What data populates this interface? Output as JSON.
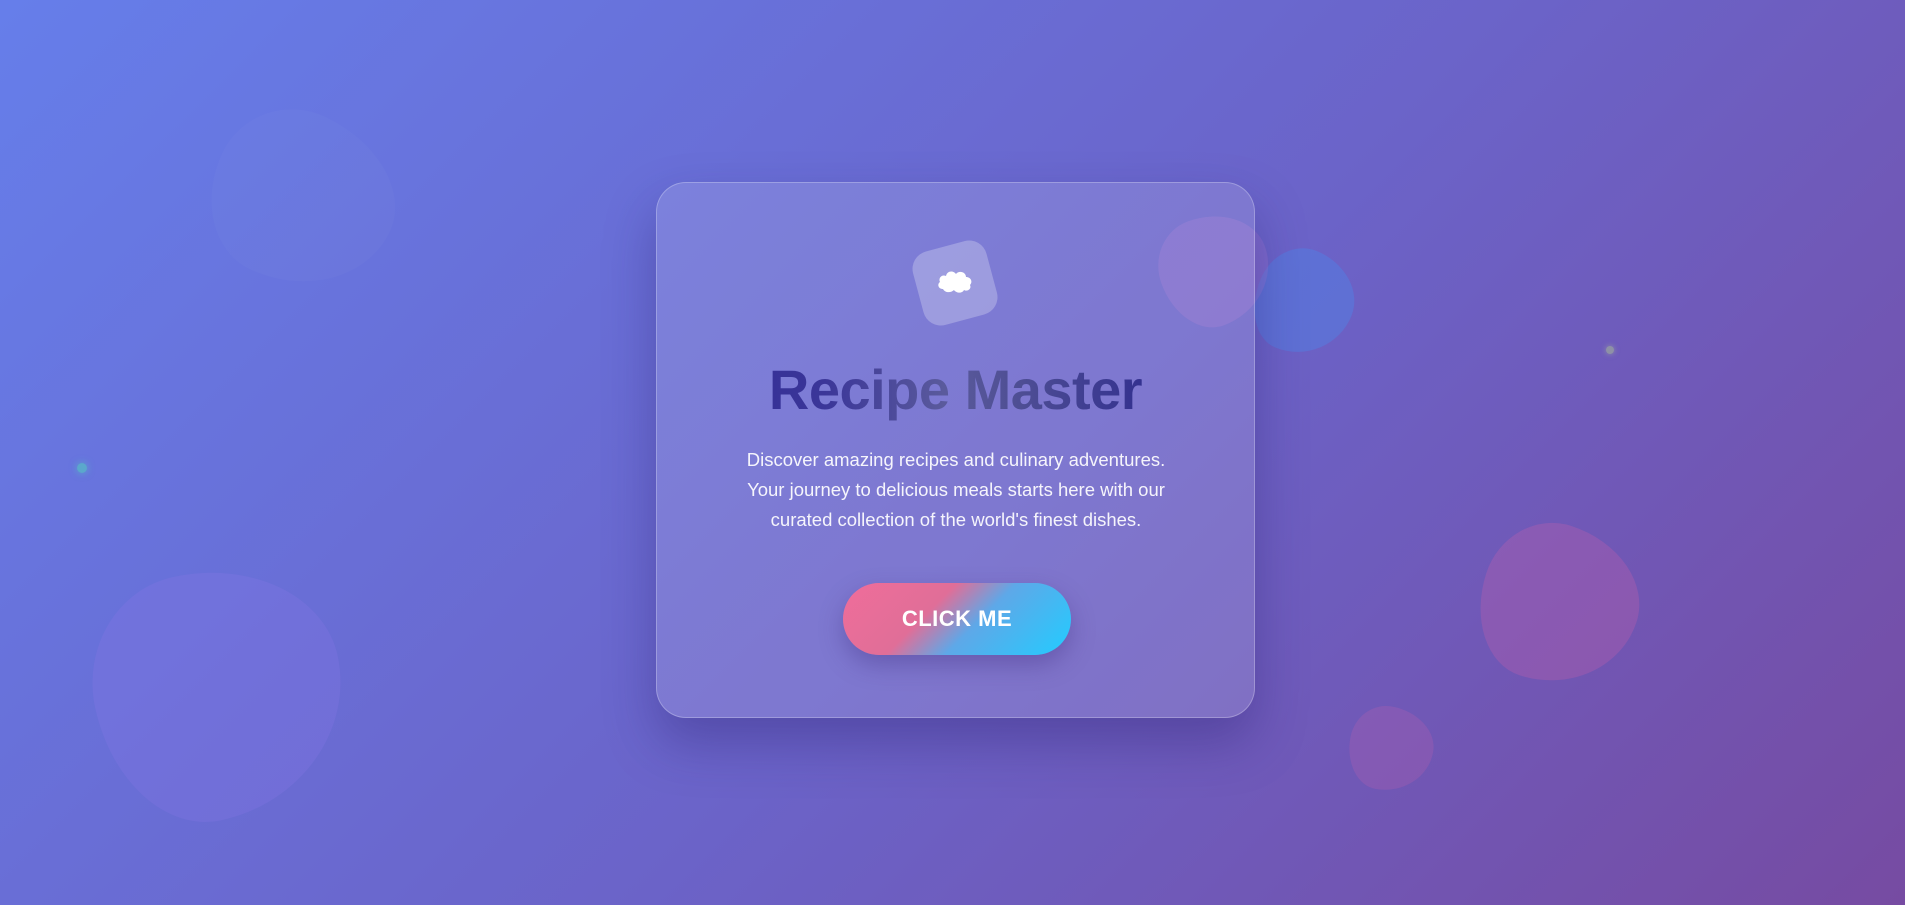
{
  "card": {
    "logo_icon": "cloud-icon",
    "title": "Recipe Master",
    "description": "Discover amazing recipes and culinary adventures. Your journey to delicious meals starts here with our curated collection of the world's finest dishes.",
    "button_label": "CLICK ME"
  },
  "colors": {
    "background_start": "#667eea",
    "background_end": "#764ba2",
    "title_color": "#2e2a96",
    "button_gradient_start": "#f06d9a",
    "button_gradient_end": "#22ccff"
  }
}
